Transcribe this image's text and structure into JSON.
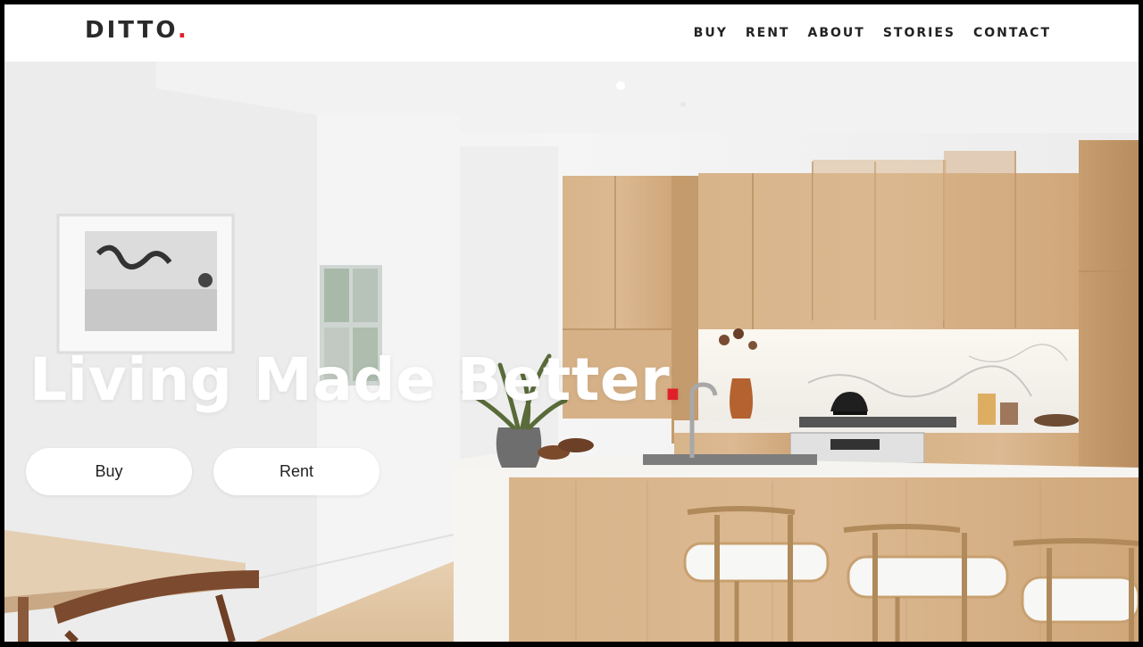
{
  "brand": {
    "name": "DITTO",
    "dot": ".",
    "accent_color": "#e0202a"
  },
  "nav": {
    "items": [
      {
        "label": "BUY"
      },
      {
        "label": "RENT"
      },
      {
        "label": "ABOUT"
      },
      {
        "label": "STORIES"
      },
      {
        "label": "CONTACT"
      }
    ]
  },
  "hero": {
    "headline": "Living Made Better",
    "headline_dot": ".",
    "buttons": {
      "buy": "Buy",
      "rent": "Rent"
    },
    "image": "kitchen-interior-photo"
  }
}
